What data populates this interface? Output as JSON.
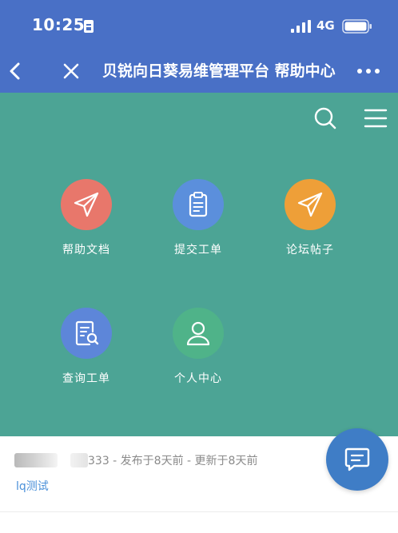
{
  "status_bar": {
    "time": "10:25",
    "network": "4G",
    "icons": [
      "sim-card-icon",
      "signal-bars-icon",
      "battery-icon"
    ]
  },
  "nav": {
    "title": "贝锐向日葵易维管理平台 帮助中心",
    "icons": [
      "back-chevron-icon",
      "close-x-icon",
      "more-dots-icon"
    ]
  },
  "toolbar": {
    "icons": [
      "search-icon",
      "hamburger-menu-icon"
    ]
  },
  "tiles": [
    {
      "label": "帮助文档",
      "icon": "paper-plane-icon",
      "color": "#e8776b"
    },
    {
      "label": "提交工单",
      "icon": "clipboard-icon",
      "color": "#5b8fdc"
    },
    {
      "label": "论坛帖子",
      "icon": "paper-plane-icon",
      "color": "#ee9f38"
    },
    {
      "label": "查询工单",
      "icon": "document-search-icon",
      "color": "#5d86d9"
    },
    {
      "label": "个人中心",
      "icon": "person-icon",
      "color": "#4fb389"
    }
  ],
  "post": {
    "meta": "333 - 发布于8天前 - 更新于8天前",
    "tag": "lq测试"
  },
  "fab": {
    "icon": "chat-message-icon",
    "color": "#3f7dc6"
  },
  "colors": {
    "header": "#4970c6",
    "panel": "#4ca495",
    "link": "#4a90d9"
  }
}
